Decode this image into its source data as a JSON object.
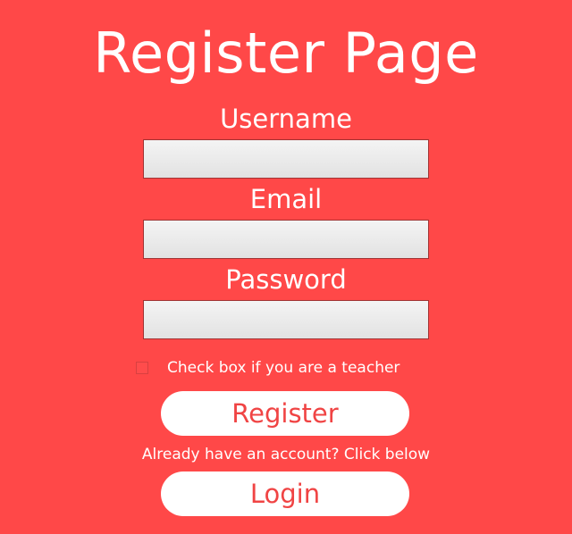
{
  "page": {
    "title": "Register Page",
    "background_color": "#ff4848",
    "accent_text_color": "#f04444"
  },
  "form": {
    "username": {
      "label": "Username",
      "value": ""
    },
    "email": {
      "label": "Email",
      "value": ""
    },
    "password": {
      "label": "Password",
      "value": ""
    },
    "teacher_checkbox": {
      "label": "Check box if you are a teacher",
      "checked": false
    },
    "register_button": {
      "label": "Register"
    }
  },
  "login": {
    "note": "Already have an account? Click below",
    "button_label": "Login"
  }
}
